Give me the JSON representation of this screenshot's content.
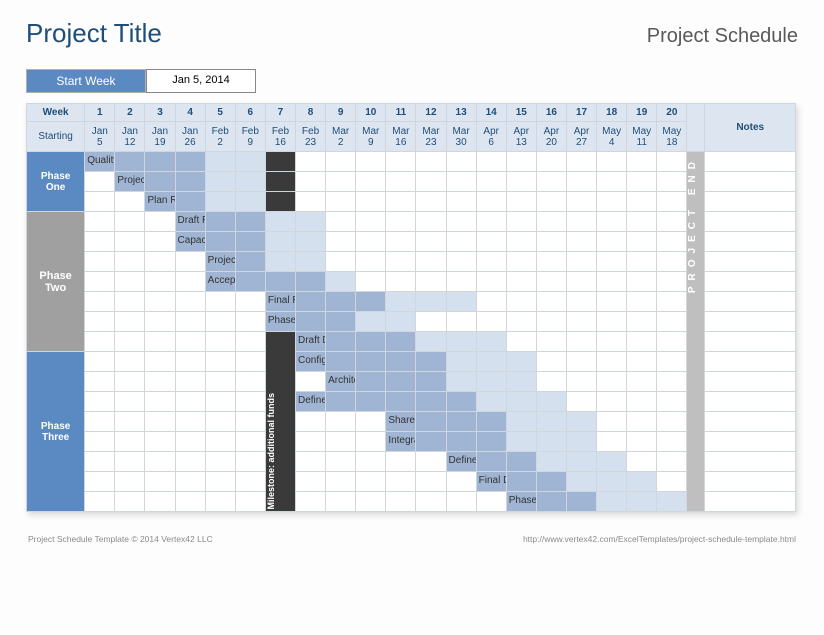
{
  "title": "Project Title",
  "subtitle": "Project Schedule",
  "start_week_label": "Start Week",
  "start_week_value": "Jan 5, 2014",
  "header": {
    "corner_top": "Week",
    "corner_bottom": "Starting",
    "weeks": [
      1,
      2,
      3,
      4,
      5,
      6,
      7,
      8,
      9,
      10,
      11,
      12,
      13,
      14,
      15,
      16,
      17,
      18,
      19,
      20
    ],
    "dates": [
      "Jan 5",
      "Jan 12",
      "Jan 19",
      "Jan 26",
      "Feb 2",
      "Feb 9",
      "Feb 16",
      "Feb 23",
      "Mar 2",
      "Mar 9",
      "Mar 16",
      "Mar 23",
      "Mar 30",
      "Apr 6",
      "Apr 13",
      "Apr 20",
      "Apr 27",
      "May 4",
      "May 11",
      "May 18"
    ],
    "notes": "Notes"
  },
  "phases": [
    "Phase",
    "One",
    " ",
    "Phase",
    "Two",
    " ",
    " ",
    " ",
    " ",
    " ",
    "Phase",
    "Three",
    " ",
    " ",
    " ",
    " ",
    " ",
    " ",
    " ",
    " "
  ],
  "milestone_label": "Milestone: additional funds",
  "end_label": "PROJECT END",
  "footer": {
    "left": "Project Schedule Template © 2014 Vertex42 LLC",
    "right": "http://www.vertex42.com/ExcelTemplates/project-schedule-template.html"
  },
  "chart_data": {
    "type": "gantt",
    "x_unit": "week",
    "x_range": [
      1,
      20
    ],
    "milestone": {
      "week": 7,
      "label": "Milestone: additional funds"
    },
    "project_end": {
      "after_week": 20
    },
    "tasks": [
      {
        "phase": "Phase One",
        "name": "Quality Assurance Plan",
        "start": 1,
        "dark_end": 4,
        "light_end": 6
      },
      {
        "phase": "Phase One",
        "name": "Project Plan",
        "start": 2,
        "dark_end": 4,
        "light_end": 6
      },
      {
        "phase": "Phase One",
        "name": "Plan Review",
        "start": 3,
        "dark_end": 4,
        "light_end": 6
      },
      {
        "phase": "Phase Two",
        "name": "Draft Requirements",
        "start": 4,
        "dark_end": 6,
        "light_end": 8
      },
      {
        "phase": "Phase Two",
        "name": "Capacity Planning",
        "start": 4,
        "dark_end": 6,
        "light_end": 8
      },
      {
        "phase": "Phase Two",
        "name": "Project Test Plan",
        "start": 5,
        "dark_end": 6,
        "light_end": 8
      },
      {
        "phase": "Phase Two",
        "name": "Acceptance Test Plan",
        "start": 5,
        "dark_end": 8,
        "light_end": 9
      },
      {
        "phase": "Phase Two",
        "name": "Final Requirements Specifications",
        "start": 7,
        "dark_end": 10,
        "light_end": 13
      },
      {
        "phase": "Phase Two",
        "name": "Phase Review and Approval",
        "start": 7,
        "dark_end": 9,
        "light_end": 11
      },
      {
        "phase": "Phase Three",
        "name": "Draft Design Specifications",
        "start": 8,
        "dark_end": 11,
        "light_end": 14
      },
      {
        "phase": "Phase Three",
        "name": "Configuration Management Plan",
        "start": 8,
        "dark_end": 12,
        "light_end": 15
      },
      {
        "phase": "Phase Three",
        "name": "Architecture Design Plan",
        "start": 9,
        "dark_end": 12,
        "light_end": 15
      },
      {
        "phase": "Phase Three",
        "name": "Define Interface Requirements",
        "start": 8,
        "dark_end": 13,
        "light_end": 16
      },
      {
        "phase": "Phase Three",
        "name": "Shared Component Design",
        "start": 11,
        "dark_end": 14,
        "light_end": 17
      },
      {
        "phase": "Phase Three",
        "name": "Integration Test Plan",
        "start": 11,
        "dark_end": 14,
        "light_end": 17
      },
      {
        "phase": "Phase Three",
        "name": "Define Project Guidelines",
        "start": 13,
        "dark_end": 15,
        "light_end": 18
      },
      {
        "phase": "Phase Three",
        "name": "Final Design Specifications",
        "start": 14,
        "dark_end": 16,
        "light_end": 19
      },
      {
        "phase": "Phase Three",
        "name": "Phase Review and Approval",
        "start": 15,
        "dark_end": 17,
        "light_end": 20
      }
    ]
  }
}
